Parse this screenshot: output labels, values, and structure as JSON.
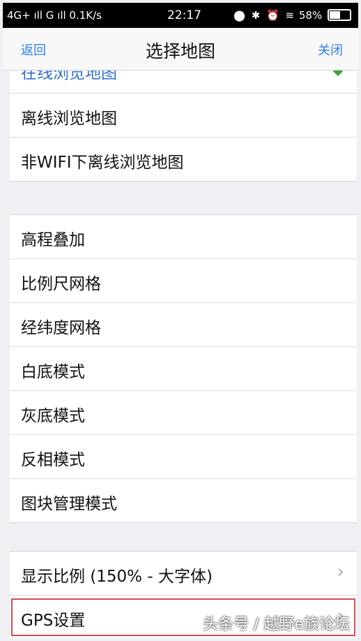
{
  "statusbar": {
    "network": "4G+ ıll G ıll 0.1K/s",
    "time": "22:17",
    "battery": "58%",
    "battery_fraction": 0.58
  },
  "navbar": {
    "back_label": "返回",
    "title": "选择地图",
    "close_label": "关闭"
  },
  "group1": {
    "items": [
      "在线浏览地图",
      "离线浏览地图",
      "非WIFI下离线浏览地图"
    ]
  },
  "group2": {
    "items": [
      "高程叠加",
      "比例尺网格",
      "经纬度网格",
      "白底模式",
      "灰底模式",
      "反相模式",
      "图块管理模式"
    ]
  },
  "group3": {
    "items": [
      "显示比例 (150% - 大字体)",
      "GPS设置"
    ]
  },
  "watermark": "头条号 / 越野e族论坛",
  "colors": {
    "accent": "#2f7cf6",
    "highlight": "#d84c4c"
  }
}
